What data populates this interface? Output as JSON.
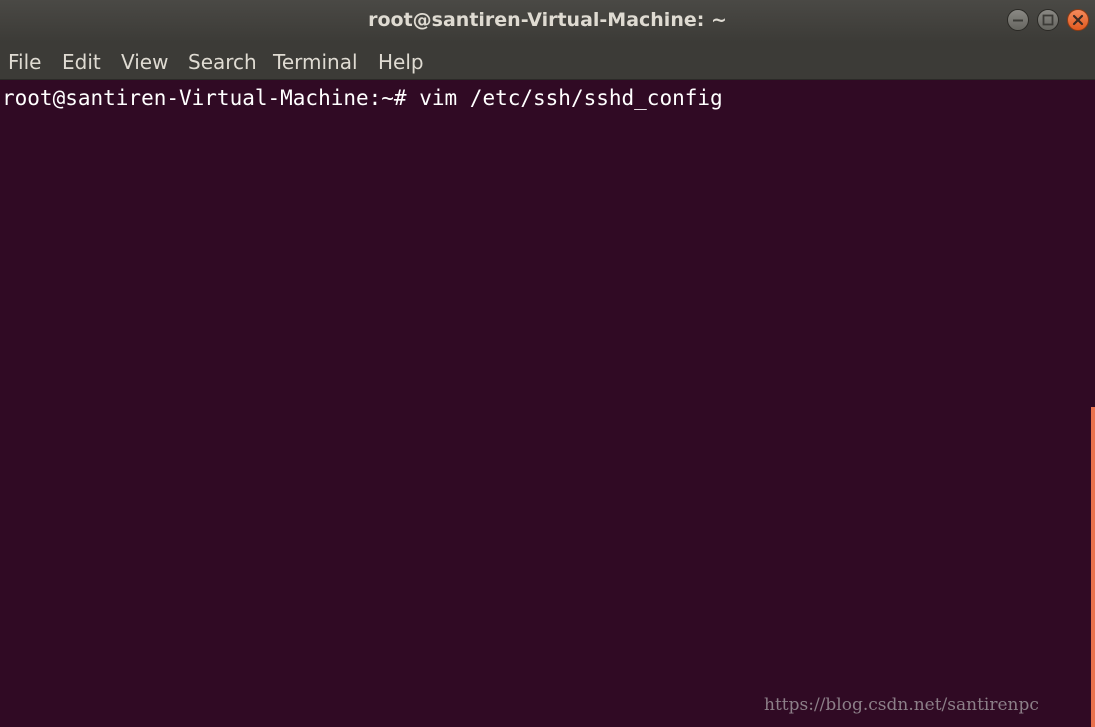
{
  "window": {
    "title": "root@santiren-Virtual-Machine: ~",
    "controls": {
      "minimize_icon": "minimize-icon",
      "maximize_icon": "maximize-icon",
      "close_icon": "close-icon",
      "close_color": "#e95420"
    }
  },
  "menubar": {
    "items": [
      "File",
      "Edit",
      "View",
      "Search",
      "Terminal",
      "Help"
    ]
  },
  "terminal": {
    "background_color": "#300a24",
    "prompt": "root@santiren-Virtual-Machine:~#",
    "command": "vim /etc/ssh/sshd_config",
    "scrollbar_color": "#e9724f"
  },
  "watermark": "https://blog.csdn.net/santirenpc"
}
